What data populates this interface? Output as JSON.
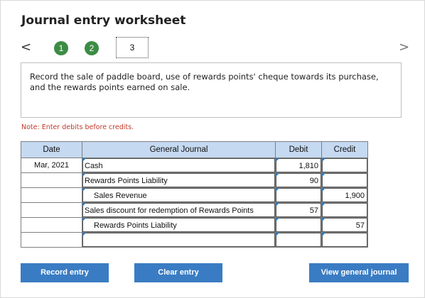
{
  "title": "Journal entry worksheet",
  "nav": {
    "prev": "<",
    "next": ">"
  },
  "steps": [
    "1",
    "2",
    "3"
  ],
  "instruction": "Record the sale of paddle board, use of rewards points' cheque towards its purchase, and the rewards points earned on sale.",
  "note": "Note: Enter debits before credits.",
  "table": {
    "headers": {
      "date": "Date",
      "journal": "General Journal",
      "debit": "Debit",
      "credit": "Credit"
    },
    "rows": [
      {
        "date": "Mar, 2021",
        "account": "Cash",
        "debit": "1,810",
        "credit": ""
      },
      {
        "date": "",
        "account": "Rewards Points Liability",
        "debit": "90",
        "credit": ""
      },
      {
        "date": "",
        "account": "Sales Revenue",
        "debit": "",
        "credit": "1,900"
      },
      {
        "date": "",
        "account": "Sales discount for redemption of Rewards Points",
        "debit": "57",
        "credit": ""
      },
      {
        "date": "",
        "account": "Rewards Points Liability",
        "debit": "",
        "credit": "57"
      },
      {
        "date": "",
        "account": "",
        "debit": "",
        "credit": ""
      }
    ]
  },
  "buttons": {
    "record": "Record entry",
    "clear": "Clear entry",
    "view": "View general journal"
  },
  "colors": {
    "accent": "#3a7cc3",
    "step_done": "#3c8c45",
    "note": "#c0392b",
    "header_bg": "#c5d9f1"
  }
}
